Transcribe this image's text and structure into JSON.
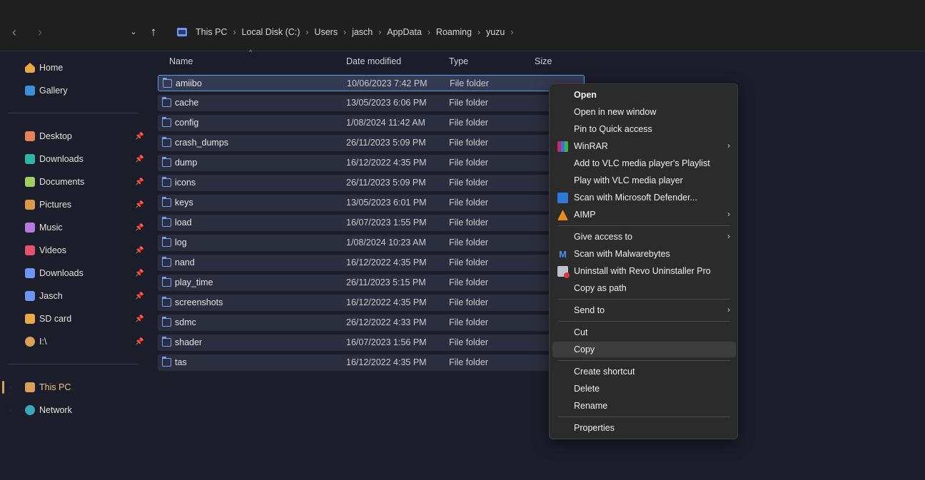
{
  "navigation": {
    "back_icon": "‹",
    "forward_icon": "›",
    "recent_icon": "⌄",
    "up_icon": "↑"
  },
  "breadcrumb": [
    "This PC",
    "Local Disk (C:)",
    "Users",
    "jasch",
    "AppData",
    "Roaming",
    "yuzu"
  ],
  "sidebar": {
    "top_items": [
      {
        "label": "Home",
        "icon": "home-icon"
      },
      {
        "label": "Gallery",
        "icon": "gallery-icon"
      }
    ],
    "pinned_items": [
      {
        "label": "Desktop",
        "icon": "desktop-icon"
      },
      {
        "label": "Downloads",
        "icon": "downloads-icon"
      },
      {
        "label": "Documents",
        "icon": "documents-icon"
      },
      {
        "label": "Pictures",
        "icon": "pictures-icon"
      },
      {
        "label": "Music",
        "icon": "music-icon"
      },
      {
        "label": "Videos",
        "icon": "videos-icon"
      },
      {
        "label": "Downloads",
        "icon": "folder-icon"
      },
      {
        "label": "Jasch",
        "icon": "folder-icon"
      },
      {
        "label": "SD card",
        "icon": "drive-icon"
      },
      {
        "label": "I:\\",
        "icon": "drive-icon"
      }
    ],
    "bottom_items": [
      {
        "label": "This PC",
        "icon": "this-pc-icon",
        "active": true
      },
      {
        "label": "Network",
        "icon": "network-icon"
      }
    ]
  },
  "columns": {
    "name": "Name",
    "date_modified": "Date modified",
    "type": "Type",
    "size": "Size"
  },
  "files": [
    {
      "name": "amiibo",
      "date": "10/06/2023 7:42 PM",
      "type": "File folder",
      "selected": true
    },
    {
      "name": "cache",
      "date": "13/05/2023 6:06 PM",
      "type": "File folder"
    },
    {
      "name": "config",
      "date": "1/08/2024 11:42 AM",
      "type": "File folder"
    },
    {
      "name": "crash_dumps",
      "date": "26/11/2023 5:09 PM",
      "type": "File folder"
    },
    {
      "name": "dump",
      "date": "16/12/2022 4:35 PM",
      "type": "File folder"
    },
    {
      "name": "icons",
      "date": "26/11/2023 5:09 PM",
      "type": "File folder"
    },
    {
      "name": "keys",
      "date": "13/05/2023 6:01 PM",
      "type": "File folder"
    },
    {
      "name": "load",
      "date": "16/07/2023 1:55 PM",
      "type": "File folder"
    },
    {
      "name": "log",
      "date": "1/08/2024 10:23 AM",
      "type": "File folder"
    },
    {
      "name": "nand",
      "date": "16/12/2022 4:35 PM",
      "type": "File folder"
    },
    {
      "name": "play_time",
      "date": "26/11/2023 5:15 PM",
      "type": "File folder"
    },
    {
      "name": "screenshots",
      "date": "16/12/2022 4:35 PM",
      "type": "File folder"
    },
    {
      "name": "sdmc",
      "date": "26/12/2022 4:33 PM",
      "type": "File folder"
    },
    {
      "name": "shader",
      "date": "16/07/2023 1:56 PM",
      "type": "File folder"
    },
    {
      "name": "tas",
      "date": "16/12/2022 4:35 PM",
      "type": "File folder"
    }
  ],
  "context_menu": {
    "open": "Open",
    "open_new_window": "Open in new window",
    "pin_quick_access": "Pin to Quick access",
    "winrar": "WinRAR",
    "vlc_playlist": "Add to VLC media player's Playlist",
    "vlc_play": "Play with VLC media player",
    "defender": "Scan with Microsoft Defender...",
    "aimp": "AIMP",
    "give_access": "Give access to",
    "malwarebytes": "Scan with Malwarebytes",
    "revo": "Uninstall with Revo Uninstaller Pro",
    "copy_path": "Copy as path",
    "send_to": "Send to",
    "cut": "Cut",
    "copy": "Copy",
    "create_shortcut": "Create shortcut",
    "delete": "Delete",
    "rename": "Rename",
    "properties": "Properties"
  },
  "colors": {
    "background": "#1b1d2b",
    "selection_border": "#5aa6d8",
    "folder_icon": "#7aa0f5",
    "menu_bg": "#2b2b2b"
  }
}
